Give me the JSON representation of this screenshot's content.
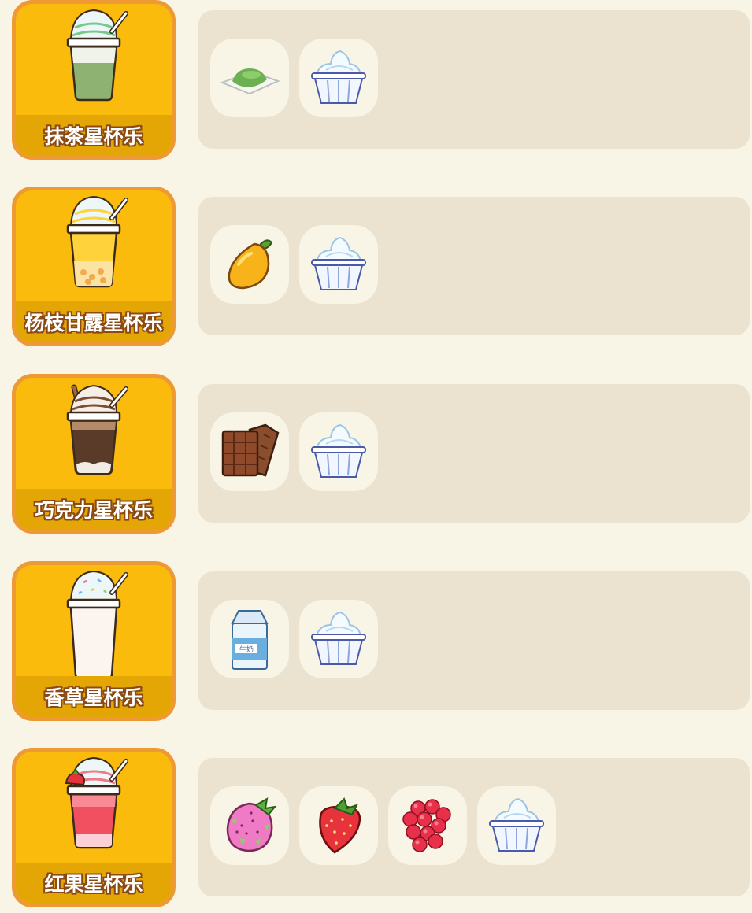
{
  "drinks": [
    {
      "name": "抹茶星杯乐",
      "cup_icon": "matcha-frappe-icon",
      "cup_color": "#8eb272",
      "ingredients": [
        {
          "name": "matcha-powder-icon"
        },
        {
          "name": "whipped-cream-cup-icon"
        }
      ]
    },
    {
      "name": "杨枝甘露星杯乐",
      "cup_icon": "mango-frappe-icon",
      "cup_color": "#fdd23a",
      "ingredients": [
        {
          "name": "mango-icon"
        },
        {
          "name": "whipped-cream-cup-icon"
        }
      ]
    },
    {
      "name": "巧克力星杯乐",
      "cup_icon": "chocolate-frappe-icon",
      "cup_color": "#5a3a28",
      "ingredients": [
        {
          "name": "chocolate-bar-icon"
        },
        {
          "name": "whipped-cream-cup-icon"
        }
      ]
    },
    {
      "name": "香草星杯乐",
      "cup_icon": "vanilla-frappe-icon",
      "cup_color": "#fbf4ef",
      "ingredients": [
        {
          "name": "milk-carton-icon",
          "text": "牛奶"
        },
        {
          "name": "whipped-cream-cup-icon"
        }
      ]
    },
    {
      "name": "红果星杯乐",
      "cup_icon": "red-fruit-frappe-icon",
      "cup_color": "#f0505f",
      "ingredients": [
        {
          "name": "dragon-fruit-icon"
        },
        {
          "name": "strawberry-icon"
        },
        {
          "name": "raspberry-icon"
        },
        {
          "name": "whipped-cream-cup-icon"
        }
      ]
    }
  ]
}
